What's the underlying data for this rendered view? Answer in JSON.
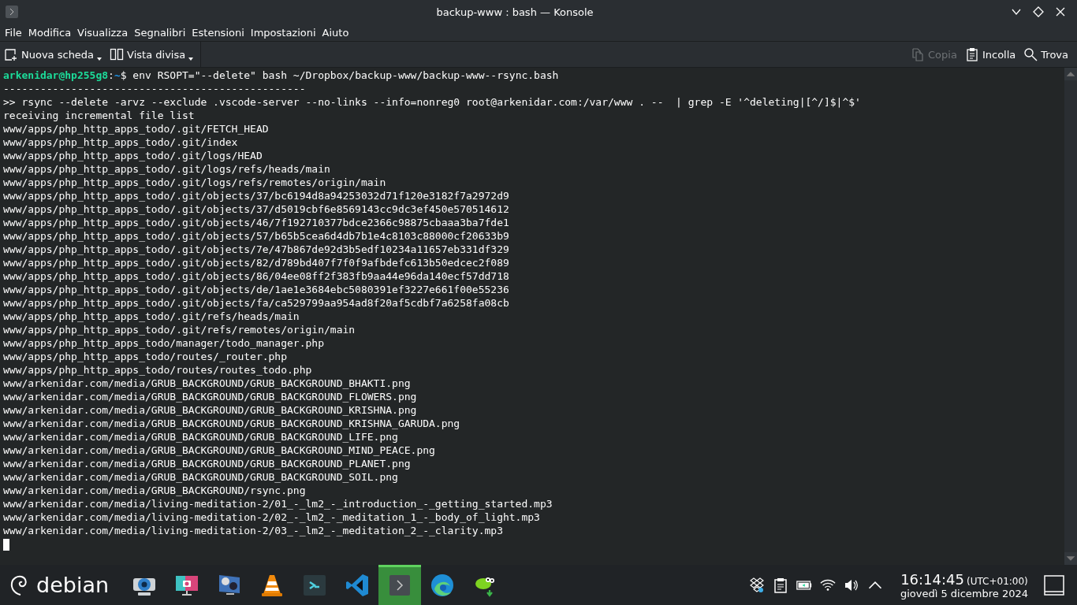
{
  "window": {
    "title": "backup-www : bash — Konsole"
  },
  "menu": [
    "File",
    "Modifica",
    "Visualizza",
    "Segnalibri",
    "Estensioni",
    "Impostazioni",
    "Aiuto"
  ],
  "toolbar": {
    "left": [
      {
        "kind": "new-tab",
        "label": "Nuova scheda"
      },
      {
        "kind": "split",
        "label": "Vista divisa"
      }
    ],
    "right": [
      {
        "kind": "copy",
        "label": "Copia",
        "disabled": true
      },
      {
        "kind": "paste",
        "label": "Incolla",
        "disabled": false
      },
      {
        "kind": "find",
        "label": "Trova",
        "disabled": false
      }
    ]
  },
  "terminal": {
    "prompt": {
      "user": "arkenidar@hp255g8",
      "sep": ":",
      "path": "~",
      "symbol": "$",
      "command": "env RSOPT=\"--delete\" bash ~/Dropbox/backup-www/backup-www--rsync.bash"
    },
    "lines": [
      "-------------------------------------------------",
      ">> rsync --delete -arvz --exclude .vscode-server --no-links --info=nonreg0 root@arkenidar.com:/var/www . --  | grep -E '^deleting|[^/]$|^$'",
      "receiving incremental file list",
      "www/apps/php_http_apps_todo/.git/FETCH_HEAD",
      "www/apps/php_http_apps_todo/.git/index",
      "www/apps/php_http_apps_todo/.git/logs/HEAD",
      "www/apps/php_http_apps_todo/.git/logs/refs/heads/main",
      "www/apps/php_http_apps_todo/.git/logs/refs/remotes/origin/main",
      "www/apps/php_http_apps_todo/.git/objects/37/bc6194d8a94253032d71f120e3182f7a2972d9",
      "www/apps/php_http_apps_todo/.git/objects/37/d5019cbf6e8569143cc9dc3ef450e570514612",
      "www/apps/php_http_apps_todo/.git/objects/46/7f192710377bdce2366c98875cbaaa3ba7fde1",
      "www/apps/php_http_apps_todo/.git/objects/57/b65b5cea6d4db7b1e4c8103c88000cf20633b9",
      "www/apps/php_http_apps_todo/.git/objects/7e/47b867de92d3b5edf10234a11657eb331df329",
      "www/apps/php_http_apps_todo/.git/objects/82/d789bd407f7f0f9afbdefc613b50edcec2f089",
      "www/apps/php_http_apps_todo/.git/objects/86/04ee08ff2f383fb9aa44e96da140ecf57dd718",
      "www/apps/php_http_apps_todo/.git/objects/de/1ae1e3684ebc5080391ef3227e661f00e55236",
      "www/apps/php_http_apps_todo/.git/objects/fa/ca529799aa954ad8f20af5cdbf7a6258fa08cb",
      "www/apps/php_http_apps_todo/.git/refs/heads/main",
      "www/apps/php_http_apps_todo/.git/refs/remotes/origin/main",
      "www/apps/php_http_apps_todo/manager/todo_manager.php",
      "www/apps/php_http_apps_todo/routes/_router.php",
      "www/apps/php_http_apps_todo/routes/routes_todo.php",
      "www/arkenidar.com/media/GRUB_BACKGROUND/GRUB_BACKGROUND_BHAKTI.png",
      "www/arkenidar.com/media/GRUB_BACKGROUND/GRUB_BACKGROUND_FLOWERS.png",
      "www/arkenidar.com/media/GRUB_BACKGROUND/GRUB_BACKGROUND_KRISHNA.png",
      "www/arkenidar.com/media/GRUB_BACKGROUND/GRUB_BACKGROUND_KRISHNA_GARUDA.png",
      "www/arkenidar.com/media/GRUB_BACKGROUND/GRUB_BACKGROUND_LIFE.png",
      "www/arkenidar.com/media/GRUB_BACKGROUND/GRUB_BACKGROUND_MIND_PEACE.png",
      "www/arkenidar.com/media/GRUB_BACKGROUND/GRUB_BACKGROUND_PLANET.png",
      "www/arkenidar.com/media/GRUB_BACKGROUND/GRUB_BACKGROUND_SOIL.png",
      "www/arkenidar.com/media/GRUB_BACKGROUND/rsync.png",
      "www/arkenidar.com/media/living-meditation-2/01_-_lm2_-_introduction_-_getting_started.mp3",
      "www/arkenidar.com/media/living-meditation-2/02_-_lm2_-_meditation_1_-_body_of_light.mp3",
      "www/arkenidar.com/media/living-meditation-2/03_-_lm2_-_meditation_2_-_clarity.mp3"
    ]
  },
  "taskbar": {
    "launcher": "debian",
    "apps": [
      {
        "kind": "webcam",
        "active": false
      },
      {
        "kind": "screenshot",
        "active": false
      },
      {
        "kind": "media",
        "active": false
      },
      {
        "kind": "cone",
        "active": false
      },
      {
        "kind": "prompt",
        "active": false
      },
      {
        "kind": "code",
        "active": false
      },
      {
        "kind": "terminal",
        "active": true
      },
      {
        "kind": "browser",
        "active": false
      },
      {
        "kind": "lizard",
        "active": false
      }
    ],
    "tray": [
      {
        "kind": "boxes"
      },
      {
        "kind": "clipboard"
      },
      {
        "kind": "battery"
      },
      {
        "kind": "wifi"
      },
      {
        "kind": "volume"
      },
      {
        "kind": "chevron"
      }
    ],
    "clock": {
      "time": "16:14:45",
      "timezone": "(UTC+01:00)",
      "date": "giovedì 5 dicembre 2024"
    }
  }
}
